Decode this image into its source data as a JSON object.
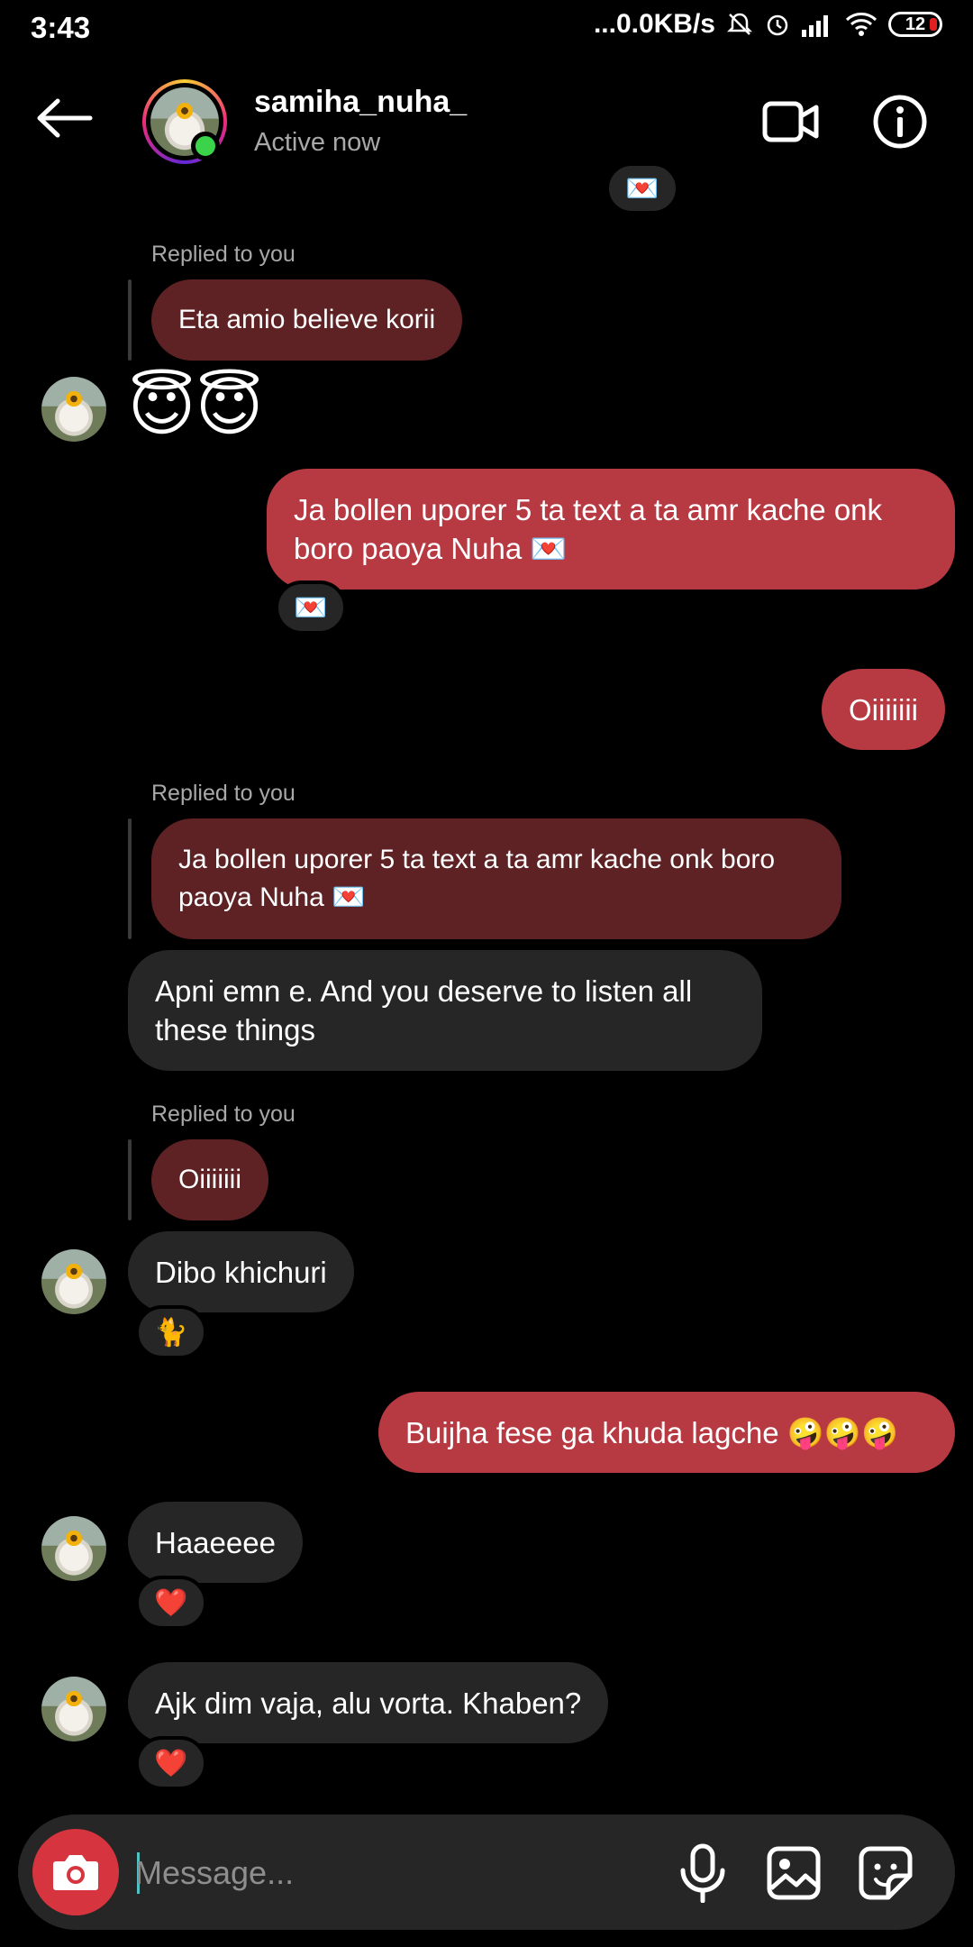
{
  "status_bar": {
    "time": "3:43",
    "network_speed": "...0.0KB/s",
    "battery": "12"
  },
  "header": {
    "contact_name": "samiha_nuha_",
    "contact_status": "Active now",
    "back_icon": "arrow-left-icon",
    "video_icon": "video-call-icon",
    "info_icon": "info-icon"
  },
  "messages": {
    "replied_label": "Replied to you",
    "m1_quote": "Eta amio believe korii",
    "m2_emoji": "😇😇",
    "m3_text": "Ja bollen uporer 5 ta text a ta amr kache onk boro paoya Nuha 💌",
    "m3_reaction": "💌",
    "m4_text": "Oiiiiiii",
    "m5_quote": "Ja bollen uporer 5 ta text a ta amr kache onk boro paoya Nuha 💌",
    "m5_text": "Apni emn e. And you deserve to listen all these things",
    "m6_quote": "Oiiiiiii",
    "m6_text": "Dibo khichuri",
    "m6_reaction": "🐈",
    "m7_text": "Buijha fese ga khuda lagche 🤪🤪🤪",
    "m8_text": "Haaeeee",
    "m8_reaction": "❤️",
    "m9_text": "Ajk dim vaja, alu vorta. Khaben?",
    "m9_reaction": "❤️"
  },
  "composer": {
    "placeholder": "Message...",
    "camera_icon": "camera-icon",
    "mic_icon": "microphone-icon",
    "gallery_icon": "gallery-icon",
    "sticker_icon": "sticker-icon"
  },
  "colors": {
    "outgoing_bubble": "#b73a43",
    "incoming_bubble": "#262626",
    "quoted_bubble": "#5e2224",
    "online": "#3bd34a"
  }
}
